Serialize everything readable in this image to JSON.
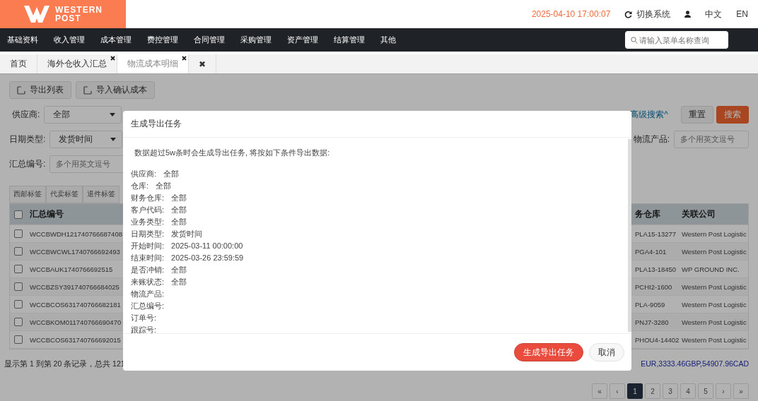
{
  "header": {
    "logo": [
      "WESTERN",
      "POST"
    ],
    "datetime": "2025-04-10 17:00:07",
    "switch_system": "切换系统",
    "languages": [
      "中文",
      "EN"
    ]
  },
  "nav": {
    "items": [
      "基础资料",
      "收入管理",
      "成本管理",
      "费控管理",
      "合同管理",
      "采购管理",
      "资产管理",
      "结算管理",
      "其他"
    ],
    "search": {
      "placeholder": "请输入菜单名称查询"
    }
  },
  "page_tabs": [
    {
      "label": "首页",
      "closable": false,
      "selected": false
    },
    {
      "label": "海外仓收入汇总",
      "closable": true,
      "selected": false
    },
    {
      "label": "物流成本明细",
      "closable": true,
      "selected": true
    },
    {
      "label": "✖",
      "closable": false,
      "selected": false
    }
  ],
  "toolbar": [
    "导出列表",
    "导入确认成本"
  ],
  "filters": {
    "supplier": {
      "label": "供应商:",
      "value": "全部"
    },
    "date_type": {
      "label": "日期类型:",
      "value": "发货时间"
    },
    "summary_no": {
      "label": "汇总编号:",
      "placeholder": "多个用英文逗号"
    },
    "logistics_product": {
      "label": "物流产品:",
      "placeholder": "多个用英文逗号"
    },
    "advanced": "高级搜索^",
    "reset": "重置",
    "search": "搜索"
  },
  "label_tabs": [
    "西邮标签",
    "代卖标签",
    "退件标签"
  ],
  "table": {
    "columns": [
      "汇总编号",
      "务仓库",
      "关联公司"
    ],
    "header_checked": false,
    "rows": [
      {
        "checked": false,
        "cells": [
          "WCCBWDH121740766687408",
          "PLA15-13277",
          "Western Post Logistic"
        ]
      },
      {
        "checked": false,
        "cells": [
          "WCCBWCWL1740766692493",
          "PGA4-101",
          "Western Post Logistic"
        ]
      },
      {
        "checked": false,
        "cells": [
          "WCCBAUK1740766692515",
          "PLA13-18450",
          "WP GROUND INC."
        ]
      },
      {
        "checked": false,
        "cells": [
          "WCCBZSY391740766684025",
          "PCHI2-1600",
          "Western Post Logistic"
        ]
      },
      {
        "checked": false,
        "cells": [
          "WCCBCOS631740766682181",
          "PLA-9059",
          "Western Post Logistic"
        ]
      },
      {
        "checked": false,
        "cells": [
          "WCCBKOM011740766690470",
          "PNJ7-3280",
          "Western Post Logistic"
        ]
      },
      {
        "checked": false,
        "cells": [
          "WCCBCOS631740766692015",
          "PHOU4-14402",
          "Western Post Logistic"
        ]
      }
    ]
  },
  "summary": {
    "records": "显示第 1 到第 20 条记录，总共 121",
    "totals": "EUR,3333.46GBP,54907.96CAD"
  },
  "pagination": [
    {
      "label": "«",
      "selected": false
    },
    {
      "label": "‹",
      "selected": false
    },
    {
      "label": "1",
      "selected": true
    },
    {
      "label": "2",
      "selected": false
    },
    {
      "label": "3",
      "selected": false
    },
    {
      "label": "4",
      "selected": false
    },
    {
      "label": "5",
      "selected": false
    },
    {
      "label": "›",
      "selected": false
    },
    {
      "label": "»",
      "selected": false
    }
  ],
  "modal": {
    "title": "生成导出任务",
    "intro": "数据超过5w条时会生成导出任务, 将按如下条件导出数据:",
    "conditions": [
      {
        "label": "供应商:",
        "value": "全部"
      },
      {
        "label": "仓库:",
        "value": "全部"
      },
      {
        "label": "财务仓库:",
        "value": "全部"
      },
      {
        "label": "客户代码:",
        "value": "全部"
      },
      {
        "label": "业务类型:",
        "value": "全部"
      },
      {
        "label": "日期类型:",
        "value": "发货时间"
      },
      {
        "label": "开始时间:",
        "value": "2025-03-11 00:00:00"
      },
      {
        "label": "结束时间:",
        "value": "2025-03-26 23:59:59"
      },
      {
        "label": "是否冲销:",
        "value": "全部"
      },
      {
        "label": "来账状态:",
        "value": "全部"
      },
      {
        "label": "物流产品:"
      },
      {
        "label": "汇总编号:"
      },
      {
        "label": "订单号:"
      },
      {
        "label": "跟踪号:"
      }
    ],
    "confirm": "生成导出任务",
    "cancel": "取消"
  }
}
